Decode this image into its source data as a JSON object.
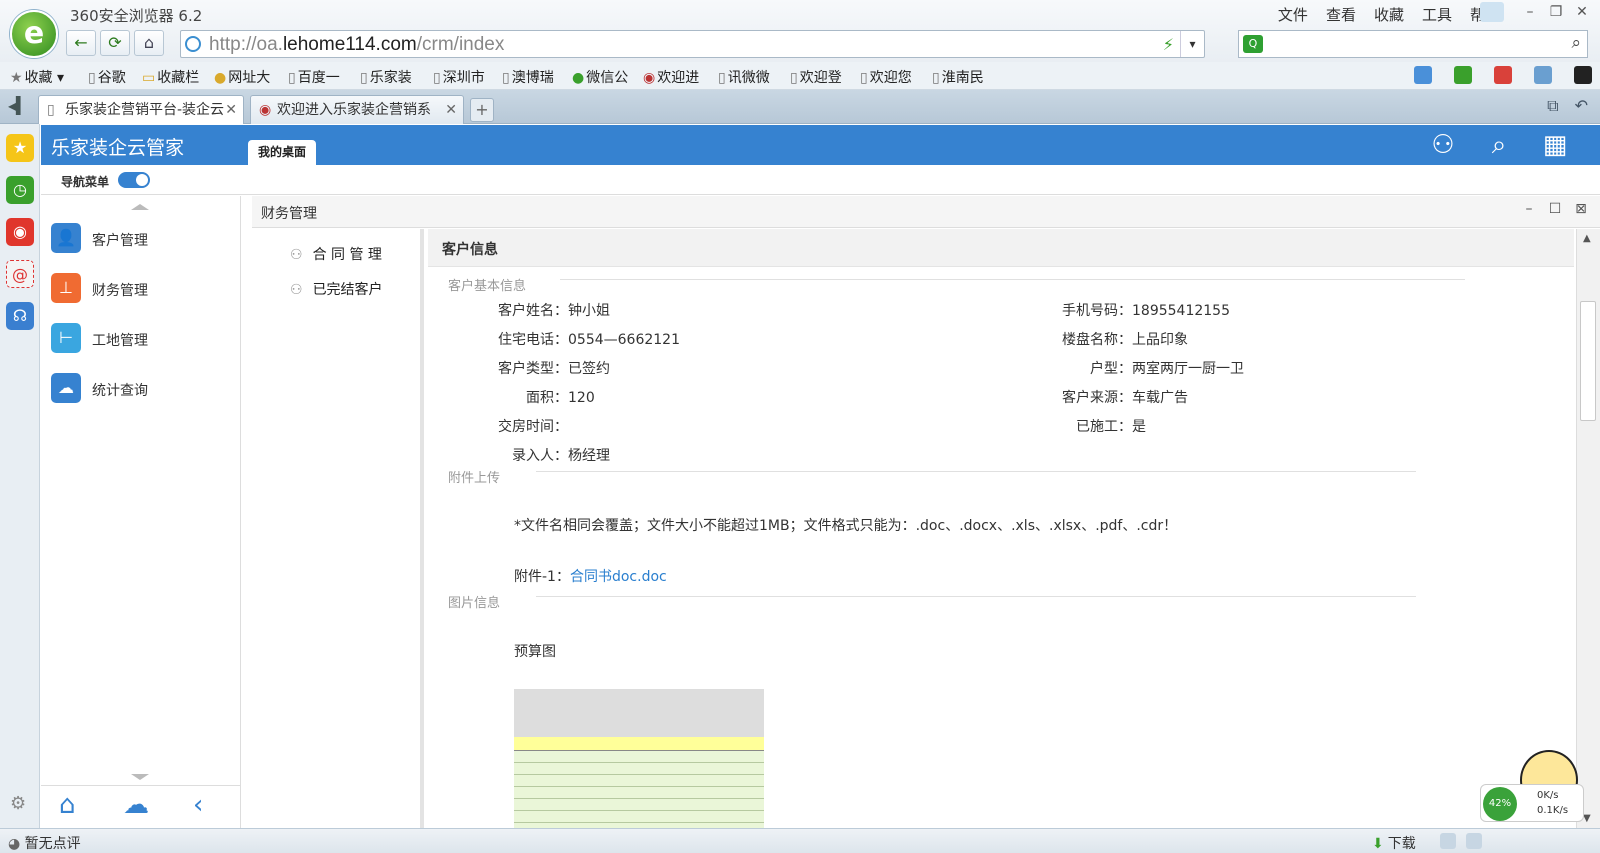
{
  "browser": {
    "title": "360安全浏览器 6.2",
    "logo_glyph": "e",
    "menu": [
      "文件",
      "查看",
      "收藏",
      "工具",
      "帮助"
    ],
    "url_prefix": "http://oa.",
    "url_domain": "lehome114.com",
    "url_path": "/crm/index",
    "bookmarks": [
      "收藏",
      "谷歌",
      "收藏栏",
      "网址大",
      "百度一",
      "乐家装",
      "深圳市",
      "澳博瑞",
      "微信公",
      "欢迎进",
      "讯微微",
      "欢迎登",
      "欢迎您",
      "淮南民"
    ],
    "tabs": [
      {
        "label": "乐家装企营销平台-装企云"
      },
      {
        "label": "欢迎进入乐家装企营销系"
      }
    ],
    "status": "暂无点评",
    "download": "下载"
  },
  "app": {
    "brand": "乐家装企云管家",
    "desk_tab": "我的桌面",
    "nav_label": "导航菜单",
    "nav_items": [
      {
        "label": "客户管理",
        "icon": "customer-icon",
        "color": "#3682d0"
      },
      {
        "label": "财务管理",
        "icon": "finance-icon",
        "color": "#f06b32"
      },
      {
        "label": "工地管理",
        "icon": "site-icon",
        "color": "#3aa6e0"
      },
      {
        "label": "统计查询",
        "icon": "stats-icon",
        "color": "#3682d0"
      }
    ]
  },
  "panel": {
    "title": "财务管理",
    "subnav": [
      "合 同 管 理",
      "已完结客户"
    ],
    "detail_title": "客户信息",
    "sections": {
      "basic": "客户基本信息",
      "attach": "附件上传",
      "images": "图片信息"
    },
    "fields_left": [
      {
        "label": "客户姓名：",
        "value": "钟小姐"
      },
      {
        "label": "住宅电话：",
        "value": "0554—6662121"
      },
      {
        "label": "客户类型：",
        "value": "已签约"
      },
      {
        "label": "面积：",
        "value": "120"
      },
      {
        "label": "交房时间：",
        "value": ""
      },
      {
        "label": "录入人：",
        "value": "杨经理"
      }
    ],
    "fields_right": [
      {
        "label": "手机号码：",
        "value": "18955412155"
      },
      {
        "label": "楼盘名称：",
        "value": "上品印象"
      },
      {
        "label": "户型：",
        "value": "两室两厅一厨一卫"
      },
      {
        "label": "客户来源：",
        "value": "车载广告"
      },
      {
        "label": "已施工：",
        "value": "是"
      }
    ],
    "attach_note": "*文件名相同会覆盖；文件大小不能超过1MB；文件格式只能为：.doc、.docx、.xls、.xlsx、.pdf、.cdr！",
    "attach_label": "附件-1：",
    "attach_file": "合同书doc.doc",
    "budget_label": "预算图"
  },
  "speed_widget": {
    "percent": "42%",
    "up": "0K/s",
    "down": "0.1K/s"
  }
}
